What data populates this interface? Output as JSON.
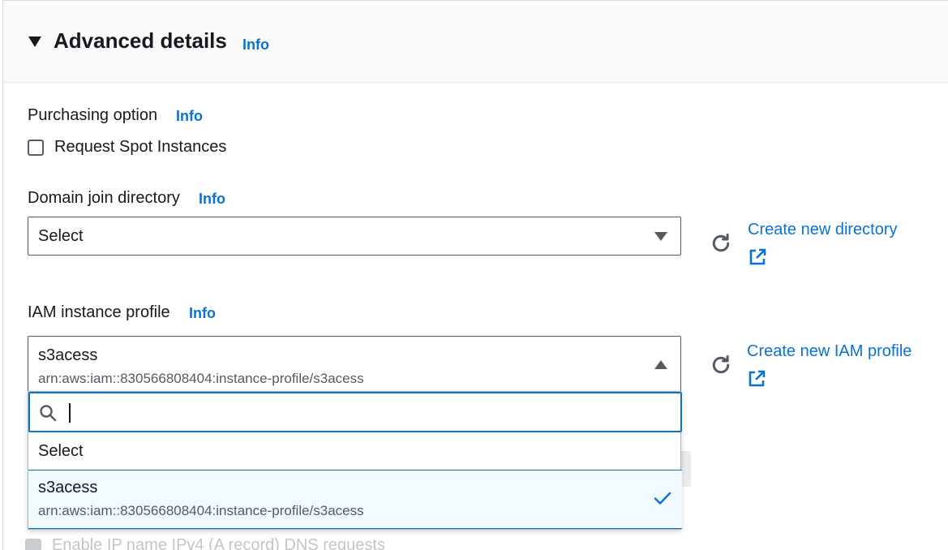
{
  "header": {
    "title": "Advanced details",
    "info": "Info"
  },
  "purchasing": {
    "label": "Purchasing option",
    "info": "Info",
    "checkbox_label": "Request Spot Instances",
    "checked": false
  },
  "domain_join": {
    "label": "Domain join directory",
    "info": "Info",
    "selected": "Select",
    "create_link": "Create new directory"
  },
  "iam_profile": {
    "label": "IAM instance profile",
    "info": "Info",
    "selected": "s3acess",
    "selected_arn": "arn:aws:iam::830566808404:instance-profile/s3acess",
    "create_link": "Create new IAM profile",
    "dropdown": {
      "search_value": "",
      "options": [
        {
          "label": "Select",
          "sub": ""
        },
        {
          "label": "s3acess",
          "sub": "arn:aws:iam::830566808404:instance-profile/s3acess",
          "selected": true
        }
      ]
    }
  },
  "hidden_row": {
    "label": "Enable IP name IPv4 (A record) DNS requests"
  },
  "colors": {
    "link": "#0972d3",
    "text": "#16191f",
    "secondary_text": "#545b64",
    "header_bg": "#fafafa",
    "selected_bg": "#f1faff"
  },
  "icons": {
    "expand": "caret-down-icon",
    "refresh": "refresh-icon",
    "external": "external-link-icon",
    "search": "search-icon",
    "check": "check-icon"
  }
}
